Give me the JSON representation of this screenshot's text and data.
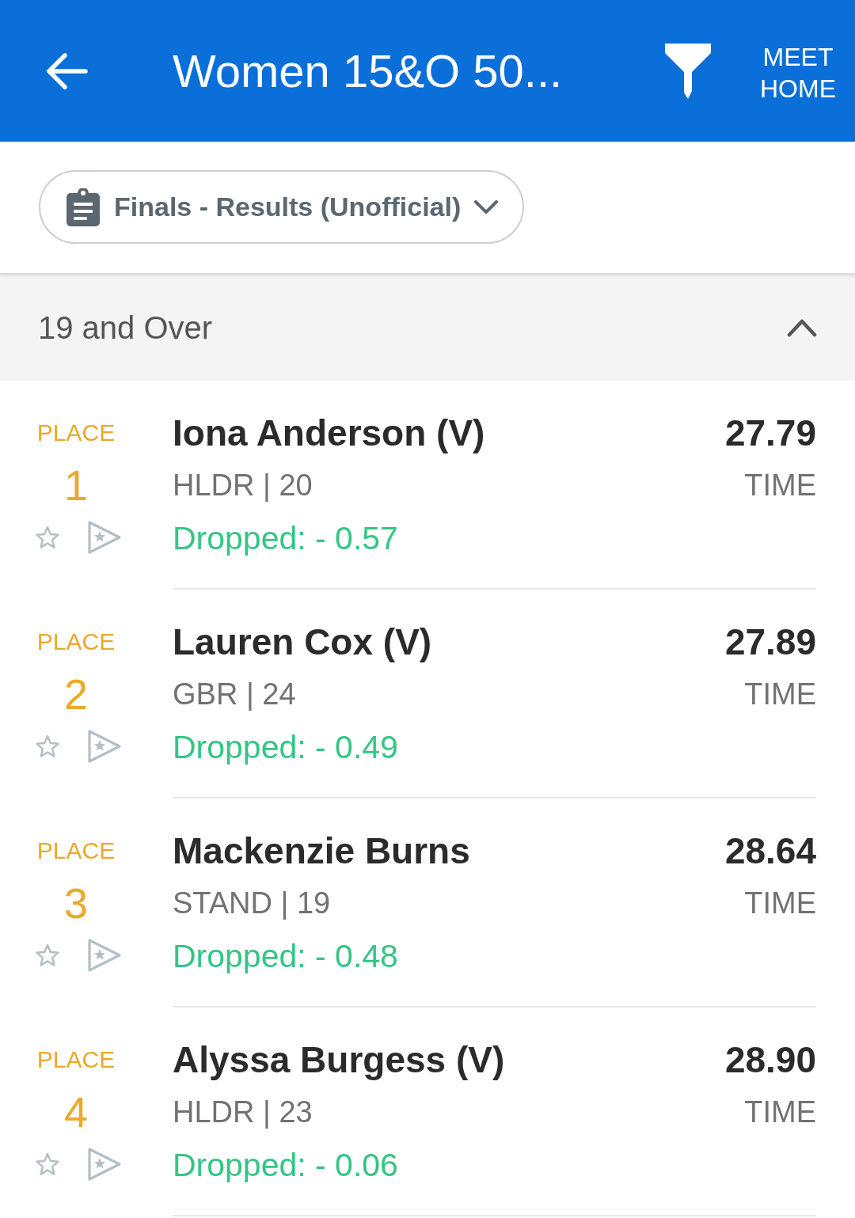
{
  "header": {
    "title": "Women 15&O 50...",
    "meet_home": "MEET HOME"
  },
  "round_selector": {
    "label": "Finals - Results (Unofficial)"
  },
  "age_group": {
    "label": "19 and Over",
    "expanded": true
  },
  "results": [
    {
      "place_label": "PLACE",
      "place": "1",
      "name": "Iona Anderson (V)",
      "team_age": "HLDR | 20",
      "dropped": "Dropped: - 0.57",
      "time": "27.79",
      "time_label": "TIME"
    },
    {
      "place_label": "PLACE",
      "place": "2",
      "name": "Lauren Cox (V)",
      "team_age": "GBR | 24",
      "dropped": "Dropped: - 0.49",
      "time": "27.89",
      "time_label": "TIME"
    },
    {
      "place_label": "PLACE",
      "place": "3",
      "name": "Mackenzie Burns",
      "team_age": "STAND | 19",
      "dropped": "Dropped: - 0.48",
      "time": "28.64",
      "time_label": "TIME"
    },
    {
      "place_label": "PLACE",
      "place": "4",
      "name": "Alyssa Burgess (V)",
      "team_age": "HLDR | 23",
      "dropped": "Dropped: - 0.06",
      "time": "28.90",
      "time_label": "TIME"
    }
  ]
}
